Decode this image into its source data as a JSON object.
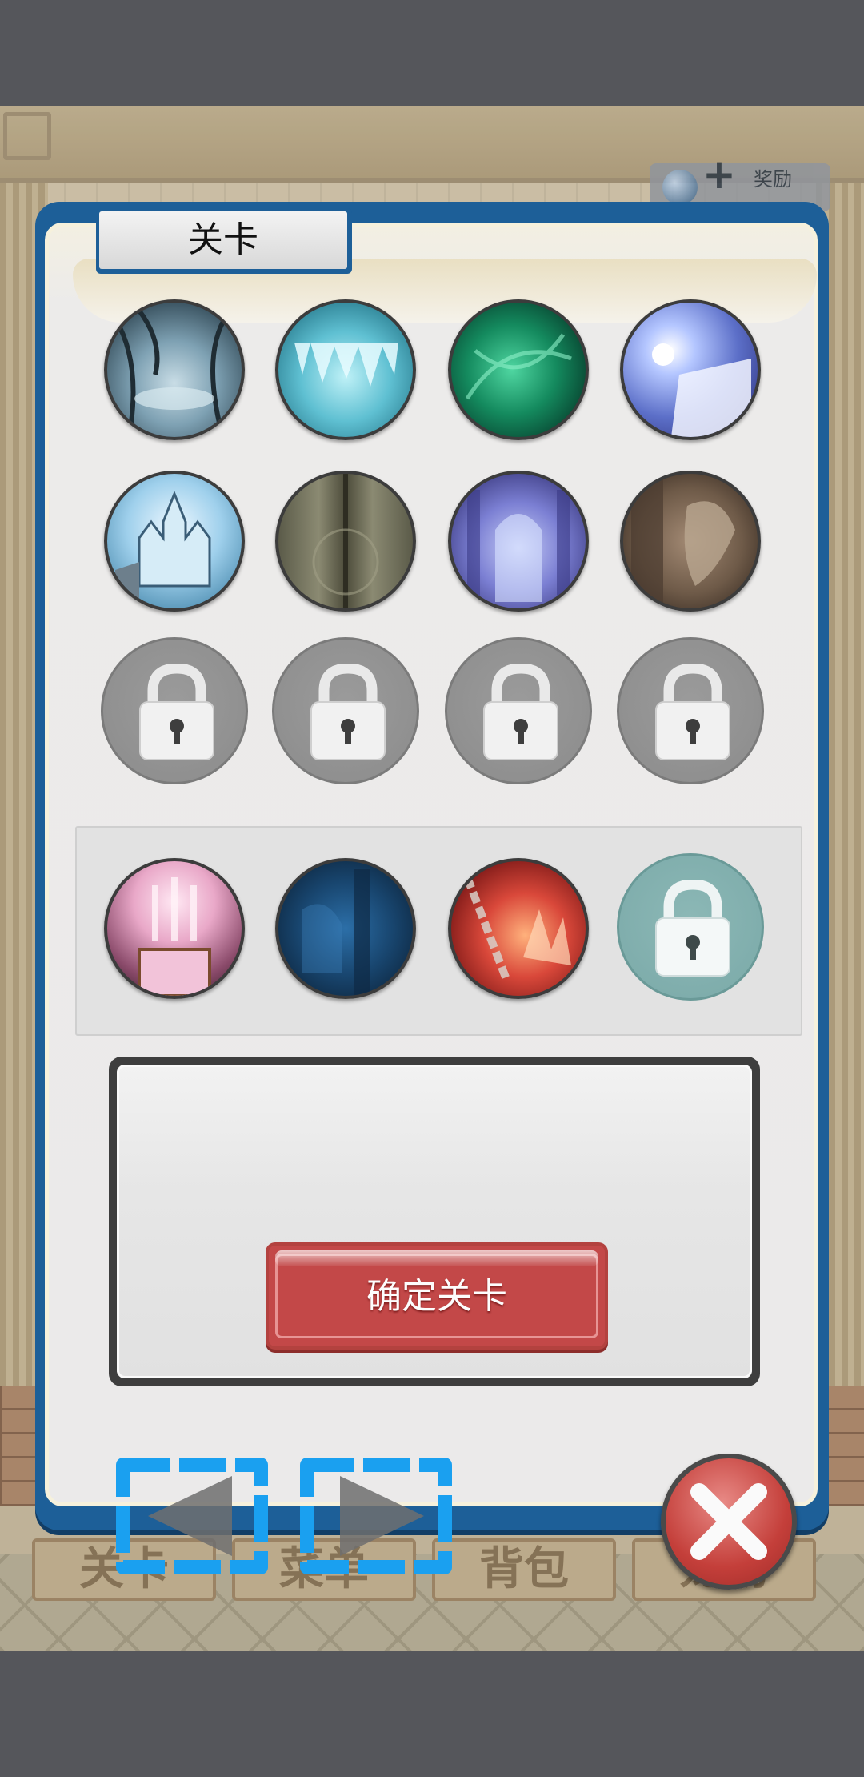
{
  "dialog": {
    "title": "关卡",
    "confirm_label": "确定关卡"
  },
  "levels": {
    "row1": [
      {
        "name": "swamp-forest",
        "state": "unlocked"
      },
      {
        "name": "ice-cave",
        "state": "unlocked"
      },
      {
        "name": "emerald-cavern",
        "state": "unlocked"
      },
      {
        "name": "frozen-waterfall",
        "state": "unlocked"
      }
    ],
    "row2": [
      {
        "name": "crystal-castle",
        "state": "unlocked"
      },
      {
        "name": "stone-corridor",
        "state": "unlocked"
      },
      {
        "name": "violet-hall",
        "state": "unlocked"
      },
      {
        "name": "gargoyle-library",
        "state": "unlocked"
      }
    ],
    "row3": [
      {
        "name": "locked",
        "state": "locked"
      },
      {
        "name": "locked",
        "state": "locked"
      },
      {
        "name": "locked",
        "state": "locked"
      },
      {
        "name": "locked",
        "state": "locked"
      }
    ],
    "special": [
      {
        "name": "rose-throne",
        "state": "unlocked"
      },
      {
        "name": "blue-dungeon",
        "state": "unlocked"
      },
      {
        "name": "chained-inferno",
        "state": "unlocked"
      },
      {
        "name": "locked-teal",
        "state": "locked"
      }
    ]
  },
  "background": {
    "bottom_tabs": [
      "关卡",
      "菜单",
      "背包",
      "宠物"
    ],
    "badge_text": "奖励"
  },
  "icons": {
    "lock": "lock-icon",
    "prev": "left-arrow-icon",
    "next": "right-arrow-icon",
    "close": "close-icon"
  },
  "colors": {
    "panel_border": "#1d5f98",
    "confirm_button": "#c34848",
    "close_button": "#c43f3a",
    "nav_outline": "#1aa0f0"
  }
}
